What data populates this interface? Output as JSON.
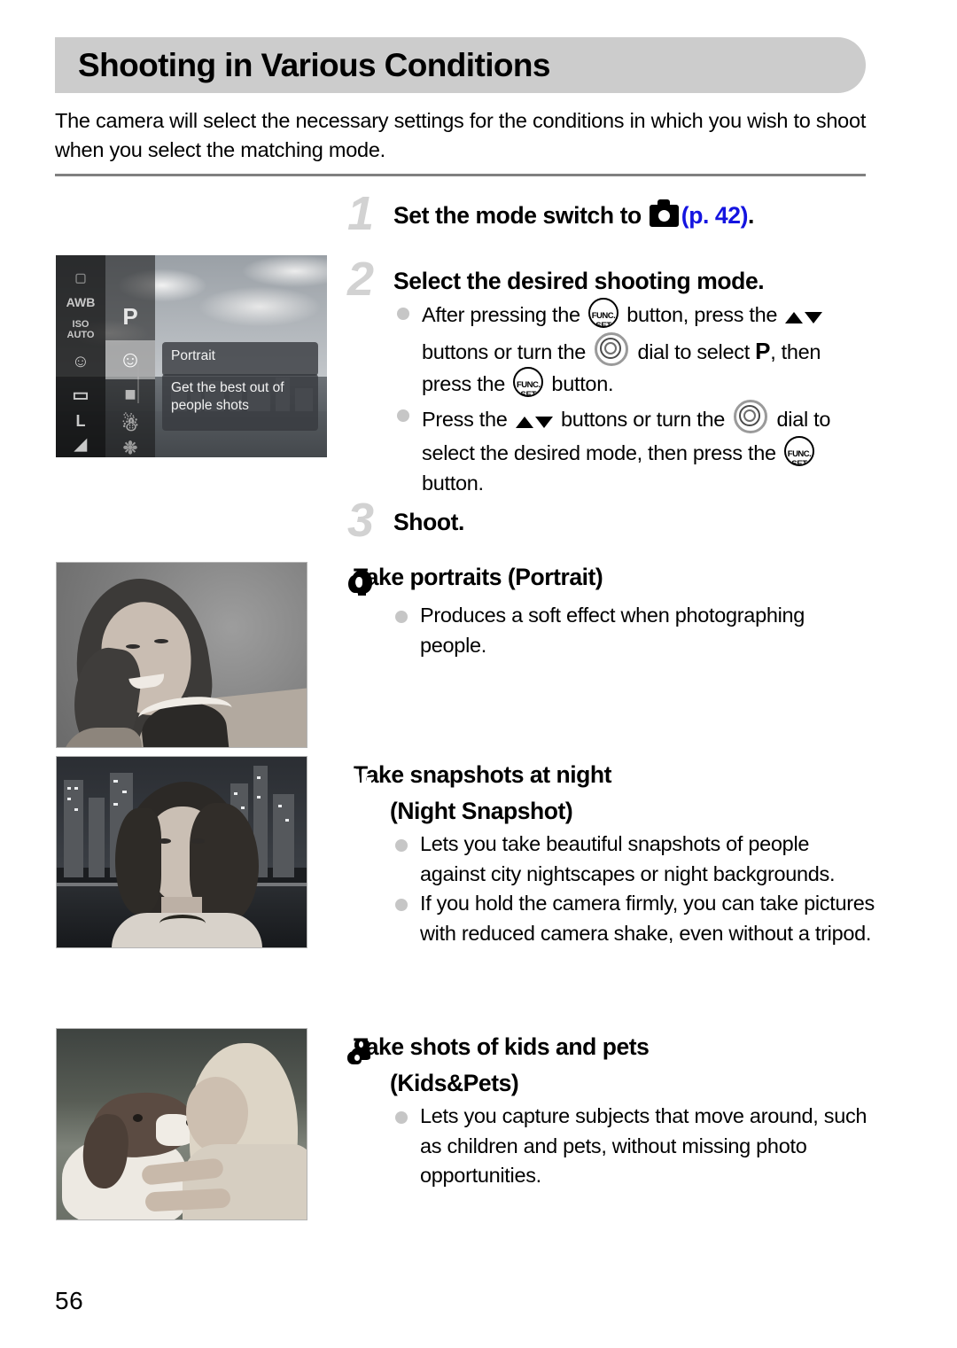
{
  "header": {
    "title": "Shooting in Various Conditions"
  },
  "intro": {
    "text": "The camera will select the necessary settings for the conditions in which you wish to shoot when you select the matching mode."
  },
  "steps": [
    {
      "number": "1",
      "title_before_icon": "Set the mode switch to ",
      "icon": "camera-icon",
      "page_ref": "(p. 42)",
      "title_after": "."
    },
    {
      "number": "2",
      "title": "Select the desired shooting mode.",
      "bullets": [
        {
          "t1": "After pressing the ",
          "i1": "funcset-button-icon",
          "t2": " button, press the ",
          "i2": "up-down-buttons-icon",
          "t3": " buttons or turn the ",
          "i3": "control-dial-icon",
          "t4": " dial to select ",
          "i4": "p-mode-icon",
          "t5": ", then press the ",
          "i5": "funcset-button-icon",
          "t6": " button."
        },
        {
          "t1": "Press the ",
          "i1": "up-down-buttons-icon",
          "t2": " buttons or turn the ",
          "i2": "control-dial-icon",
          "t3": " dial to select the desired mode, then press the ",
          "i3": "funcset-button-icon",
          "t4": " button."
        }
      ]
    },
    {
      "number": "3",
      "title": "Shoot."
    }
  ],
  "lcd_screen": {
    "selected_mode_label": "Portrait",
    "selected_mode_description_line1": "Get the best out of",
    "selected_mode_description_line2": "people shots",
    "program_mode_letter": "P",
    "left_column_icons": [
      "white-balance-awb-icon",
      "iso-auto-icon",
      "face-detect-icon",
      "aspect-ratio-icon",
      "image-size-l-icon",
      "compression-icon"
    ],
    "left_column_labels": [
      "AWB",
      "ISO\nAUTO",
      "",
      "",
      "L",
      ""
    ],
    "right_column_icons": [
      "program-p-icon",
      "portrait-mode-icon",
      "night-snapshot-mode-icon",
      "kids-and-pets-mode-icon",
      "special-scene-mode-icon"
    ]
  },
  "modes": [
    {
      "icon": "portrait-mode-icon",
      "heading": "Take portraits (Portrait)",
      "photo_alt": "portrait-sample-photo",
      "bullets": [
        "Produces a soft effect when photographing people."
      ]
    },
    {
      "icon": "night-snapshot-mode-icon",
      "heading_line1": "Take snapshots at night",
      "heading_line2": "(Night Snapshot)",
      "photo_alt": "night-snapshot-sample-photo",
      "bullets": [
        "Lets you take beautiful snapshots of people against city nightscapes or night backgrounds.",
        "If you hold the camera firmly, you can take pictures with reduced camera shake, even without a tripod."
      ]
    },
    {
      "icon": "kids-and-pets-mode-icon",
      "heading_line1": "Take shots of kids and pets",
      "heading_line2": "(Kids&Pets)",
      "photo_alt": "kids-and-pets-sample-photo",
      "bullets": [
        "Lets you capture subjects that move around, such as children and pets, without missing photo opportunities."
      ]
    }
  ],
  "footer": {
    "page_number": "56"
  },
  "colors": {
    "header_bar": "#cccccc",
    "page_ref_link": "#1414e0",
    "step_number": "#d2d2d2",
    "bullet_dot": "#c6c6c6",
    "divider": "#808080"
  }
}
